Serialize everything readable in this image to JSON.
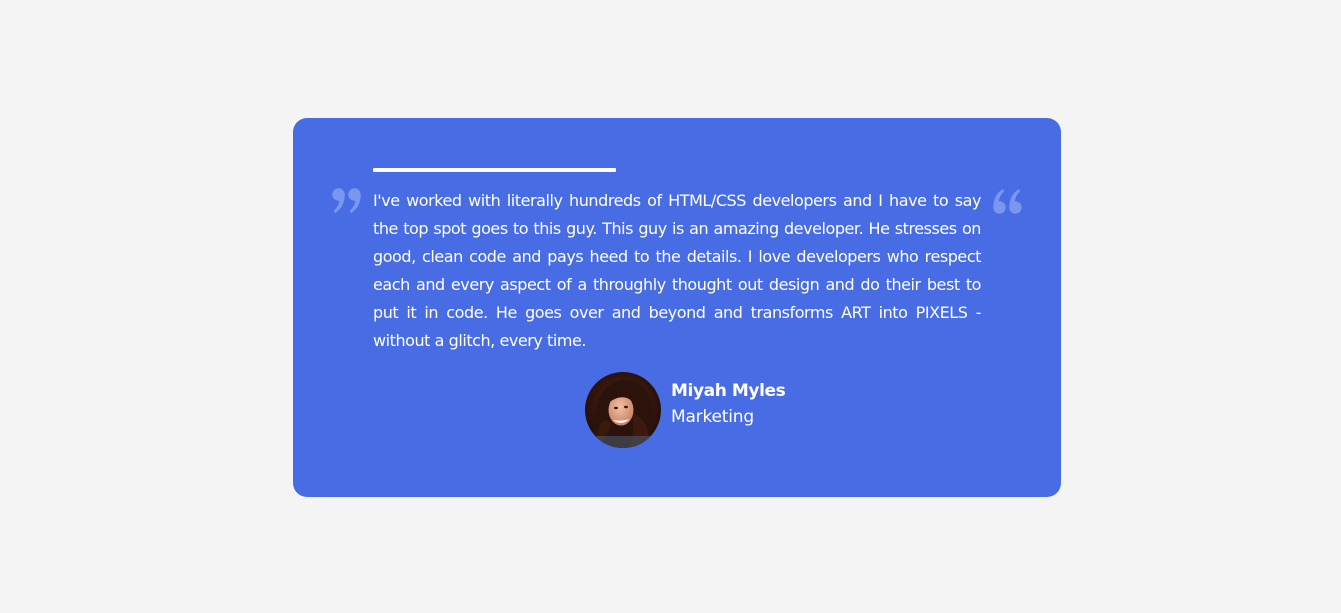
{
  "testimonial": {
    "progress": 0.4,
    "quote": "I've worked with literally hundreds of HTML/CSS developers and I have to say the top spot goes to this guy. This guy is an amazing developer. He stresses on good, clean code and pays heed to the details. I love developers who respect each and every aspect of a throughly thought out design and do their best to put it in code. He goes over and beyond and transforms ART into PIXELS - without a glitch, every time.",
    "author_name": "Miyah Myles",
    "author_role": "Marketing",
    "open_quote_icon": "quote-left-icon",
    "close_quote_icon": "quote-right-icon"
  },
  "colors": {
    "page_background": "#f4f4f4",
    "card_background": "#476ce4",
    "text": "#ffffff",
    "quote_icon": "#7a96ef"
  }
}
